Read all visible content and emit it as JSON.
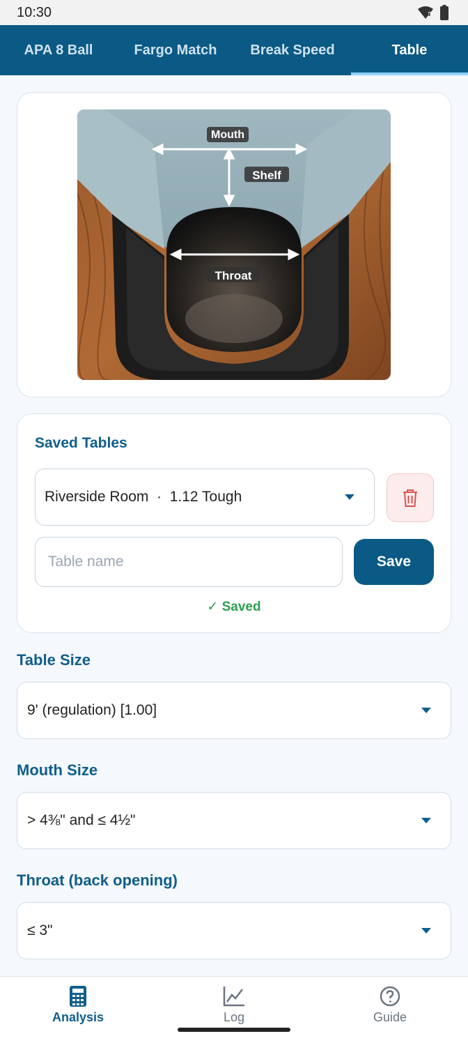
{
  "status_bar": {
    "time": "10:30"
  },
  "tabs": [
    {
      "label": "APA 8 Ball",
      "active": false
    },
    {
      "label": "Fargo Match",
      "active": false
    },
    {
      "label": "Break Speed",
      "active": false
    },
    {
      "label": "Table",
      "active": true
    }
  ],
  "diagram": {
    "labels": {
      "mouth": "Mouth",
      "shelf": "Shelf",
      "throat": "Throat"
    }
  },
  "saved_tables": {
    "title": "Saved Tables",
    "selected": "Riverside Room  ·  1.12 Tough",
    "name_placeholder": "Table name",
    "save_label": "Save",
    "status": "✓ Saved"
  },
  "table_size": {
    "label": "Table Size",
    "value": "9' (regulation) [1.00]"
  },
  "mouth_size": {
    "label": "Mouth Size",
    "value": "> 4⅜\" and ≤ 4½\""
  },
  "throat": {
    "label": "Throat (back opening)",
    "value": "≤ 3\""
  },
  "bottom_nav": [
    {
      "label": "Analysis",
      "icon": "calculator-icon",
      "active": true
    },
    {
      "label": "Log",
      "icon": "chart-line-icon",
      "active": false
    },
    {
      "label": "Guide",
      "icon": "help-circle-icon",
      "active": false
    }
  ],
  "colors": {
    "primary": "#0a5a85",
    "accent": "#8fd3ff",
    "success": "#2e9e50",
    "danger": "#d9534f"
  }
}
